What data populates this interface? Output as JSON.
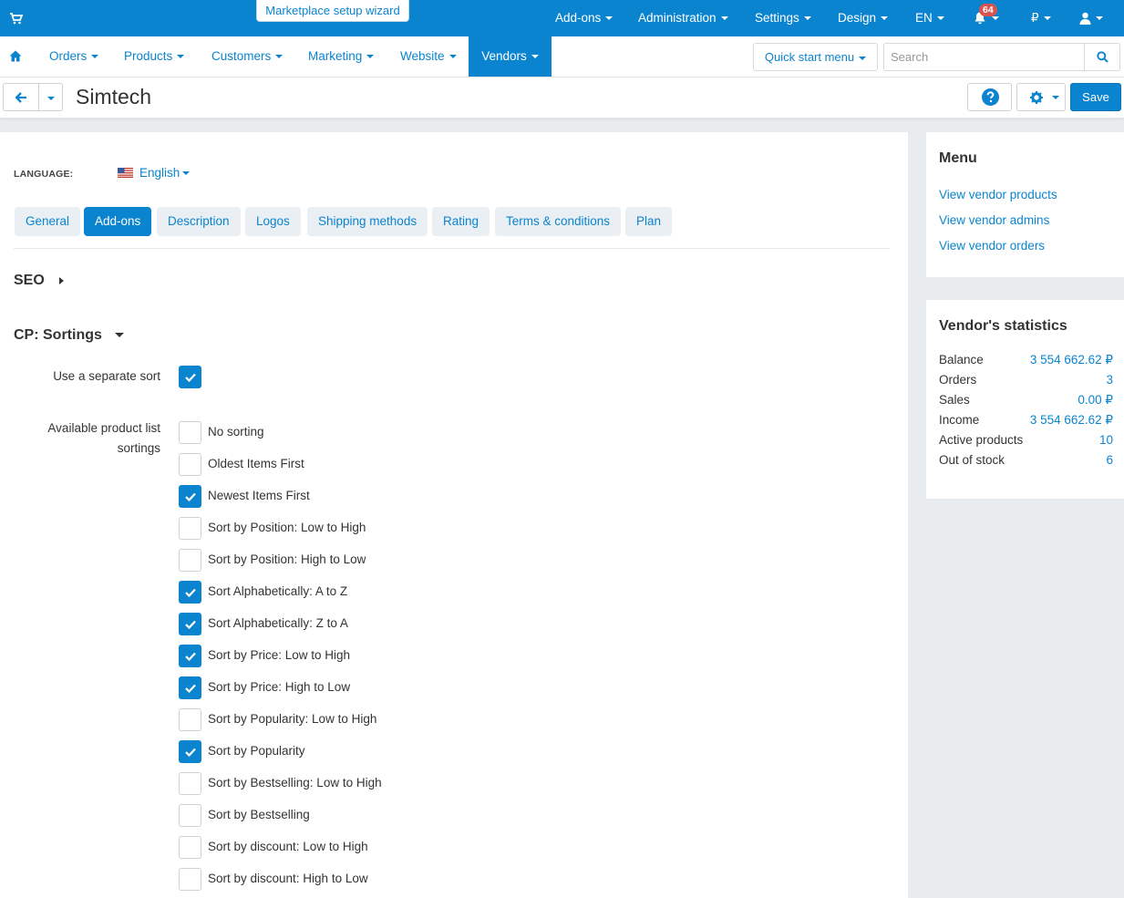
{
  "colors": {
    "accent": "#0b84d0",
    "badge": "#d9534f"
  },
  "topbar": {
    "wizard_label": "Marketplace setup wizard",
    "items": [
      "Add-ons",
      "Administration",
      "Settings",
      "Design",
      "EN"
    ],
    "notifications_count": "64",
    "currency": "₽"
  },
  "nav": {
    "items": [
      "Orders",
      "Products",
      "Customers",
      "Marketing",
      "Website",
      "Vendors"
    ],
    "active": "Vendors",
    "quick_start": "Quick start menu",
    "search_placeholder": "Search"
  },
  "titlebar": {
    "title": "Simtech",
    "save_label": "Save"
  },
  "language": {
    "label": "LANGUAGE:",
    "value": "English"
  },
  "tabs": [
    "General",
    "Add-ons",
    "Description",
    "Logos",
    "Shipping methods",
    "Rating",
    "Terms & conditions",
    "Plan"
  ],
  "active_tab": "Add-ons",
  "sections": {
    "seo": "SEO",
    "sortings": "CP: Sortings"
  },
  "fields": {
    "separate_sort_label": "Use a separate sort",
    "separate_sort_checked": true,
    "available_label_line1": "Available product list",
    "available_label_line2": "sortings"
  },
  "sortings": [
    {
      "label": "No sorting",
      "checked": false
    },
    {
      "label": "Oldest Items First",
      "checked": false
    },
    {
      "label": "Newest Items First",
      "checked": true
    },
    {
      "label": "Sort by Position: Low to High",
      "checked": false
    },
    {
      "label": "Sort by Position: High to Low",
      "checked": false
    },
    {
      "label": "Sort Alphabetically: A to Z",
      "checked": true
    },
    {
      "label": "Sort Alphabetically: Z to A",
      "checked": true
    },
    {
      "label": "Sort by Price: Low to High",
      "checked": true
    },
    {
      "label": "Sort by Price: High to Low",
      "checked": true
    },
    {
      "label": "Sort by Popularity: Low to High",
      "checked": false
    },
    {
      "label": "Sort by Popularity",
      "checked": true
    },
    {
      "label": "Sort by Bestselling: Low to High",
      "checked": false
    },
    {
      "label": "Sort by Bestselling",
      "checked": false
    },
    {
      "label": "Sort by discount: Low to High",
      "checked": false
    },
    {
      "label": "Sort by discount: High to Low",
      "checked": false
    }
  ],
  "sidebar": {
    "menu_title": "Menu",
    "menu_links": [
      "View vendor products",
      "View vendor admins",
      "View vendor orders"
    ],
    "stats_title": "Vendor's statistics",
    "stats": [
      {
        "label": "Balance",
        "value": "3 554 662.62 ₽"
      },
      {
        "label": "Orders",
        "value": "3"
      },
      {
        "label": "Sales",
        "value": "0.00 ₽"
      },
      {
        "label": "Income",
        "value": "3 554 662.62 ₽"
      },
      {
        "label": "Active products",
        "value": "10"
      },
      {
        "label": "Out of stock",
        "value": "6"
      }
    ]
  }
}
